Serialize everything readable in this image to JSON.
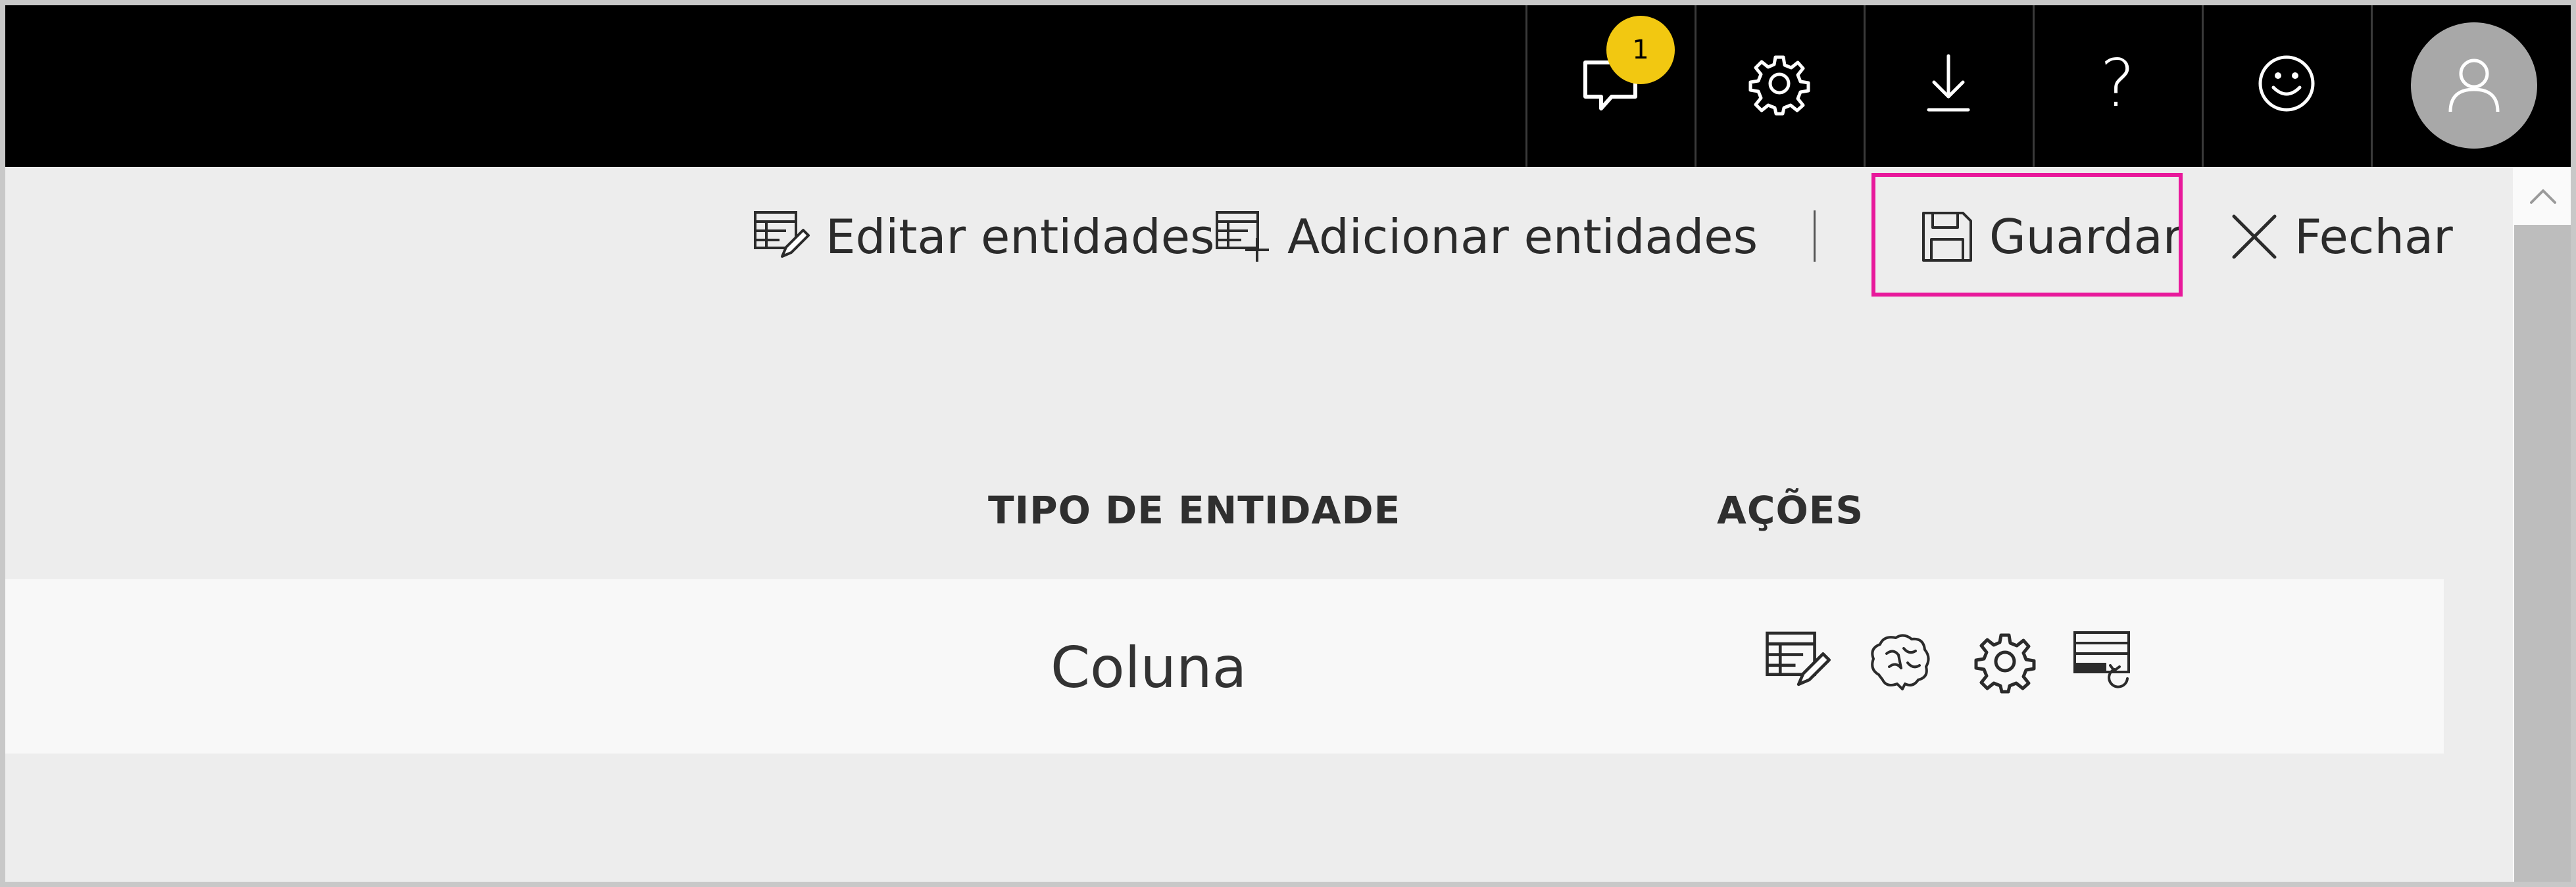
{
  "topbar": {
    "notifications": {
      "icon": "notification-icon",
      "count": "1"
    },
    "settings": {
      "icon": "gear-icon"
    },
    "download": {
      "icon": "download-icon"
    },
    "help": {
      "icon": "help-icon",
      "glyph": "?"
    },
    "feedback": {
      "icon": "smiley-icon"
    },
    "account": {
      "icon": "user-icon"
    }
  },
  "toolbar": {
    "edit_entities": "Editar entidades",
    "add_entities": "Adicionar entidades",
    "save": "Guardar",
    "close": "Fechar"
  },
  "highlight_color": "#e8199b",
  "table": {
    "headers": {
      "entity_type": "TIPO DE ENTIDADE",
      "actions": "AÇÕES"
    },
    "rows": [
      {
        "entity_type": "Coluna",
        "actions": [
          "edit-table-icon",
          "brain-icon",
          "gear-icon",
          "table-refresh-icon"
        ]
      }
    ]
  }
}
